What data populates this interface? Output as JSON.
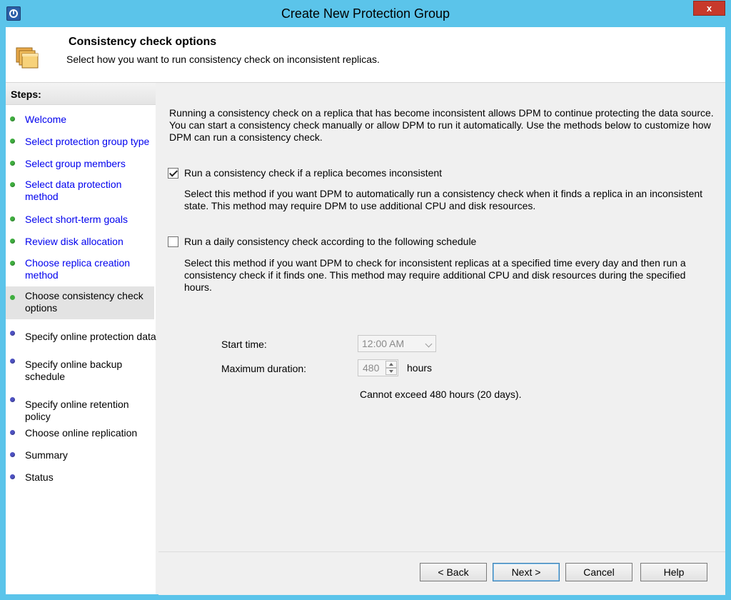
{
  "window": {
    "title": "Create New Protection Group",
    "close_label": "x"
  },
  "header": {
    "title": "Consistency check options",
    "subtitle": "Select how you want to run consistency check on inconsistent replicas."
  },
  "steps": {
    "heading": "Steps:",
    "items": [
      {
        "label": "Welcome",
        "state": "done"
      },
      {
        "label": "Select protection group type",
        "state": "done"
      },
      {
        "label": "Select group members",
        "state": "done"
      },
      {
        "label": "Select data protection method",
        "state": "done"
      },
      {
        "label": "Select short-term goals",
        "state": "done"
      },
      {
        "label": "Review disk allocation",
        "state": "done"
      },
      {
        "label": "Choose replica creation method",
        "state": "done"
      },
      {
        "label": "Choose consistency check options",
        "state": "current"
      },
      {
        "label": "Specify online protection data",
        "state": "todo"
      },
      {
        "label": "Specify online backup schedule",
        "state": "todo"
      },
      {
        "label": "Specify online retention policy",
        "state": "todo"
      },
      {
        "label": "Choose online replication",
        "state": "todo"
      },
      {
        "label": "Summary",
        "state": "todo"
      },
      {
        "label": "Status",
        "state": "todo"
      }
    ]
  },
  "main": {
    "intro": "Running a consistency check on a replica that has become inconsistent allows DPM to continue protecting the data source. You can start a consistency check manually or allow DPM to run it automatically. Use the methods below to customize how DPM can run a consistency check.",
    "option_inconsistent": {
      "label": "Run a consistency check if a replica becomes inconsistent",
      "checked": true,
      "description": "Select this method if you want DPM to automatically run a consistency check when it finds a replica in an inconsistent state. This method may require DPM to use additional CPU and disk resources."
    },
    "option_daily": {
      "label": "Run a daily consistency check according to the following schedule",
      "checked": false,
      "description": "Select this method if you want DPM to check for inconsistent replicas at a specified time every day and then run a consistency check if it finds one. This method may require additional CPU and disk resources during the specified hours."
    },
    "start_time": {
      "label": "Start time:",
      "value": "12:00 AM"
    },
    "max_duration": {
      "label": "Maximum duration:",
      "value": "480",
      "unit": "hours"
    },
    "limit_note": "Cannot exceed 480 hours (20 days)."
  },
  "buttons": {
    "back": "< Back",
    "next": "Next >",
    "cancel": "Cancel",
    "help": "Help"
  },
  "colors": {
    "window_frame": "#5bc4ea",
    "link": "#0000ee",
    "done_bullet": "#3fae3f",
    "todo_bullet": "#4e52c2",
    "close_button": "#c7392b"
  }
}
